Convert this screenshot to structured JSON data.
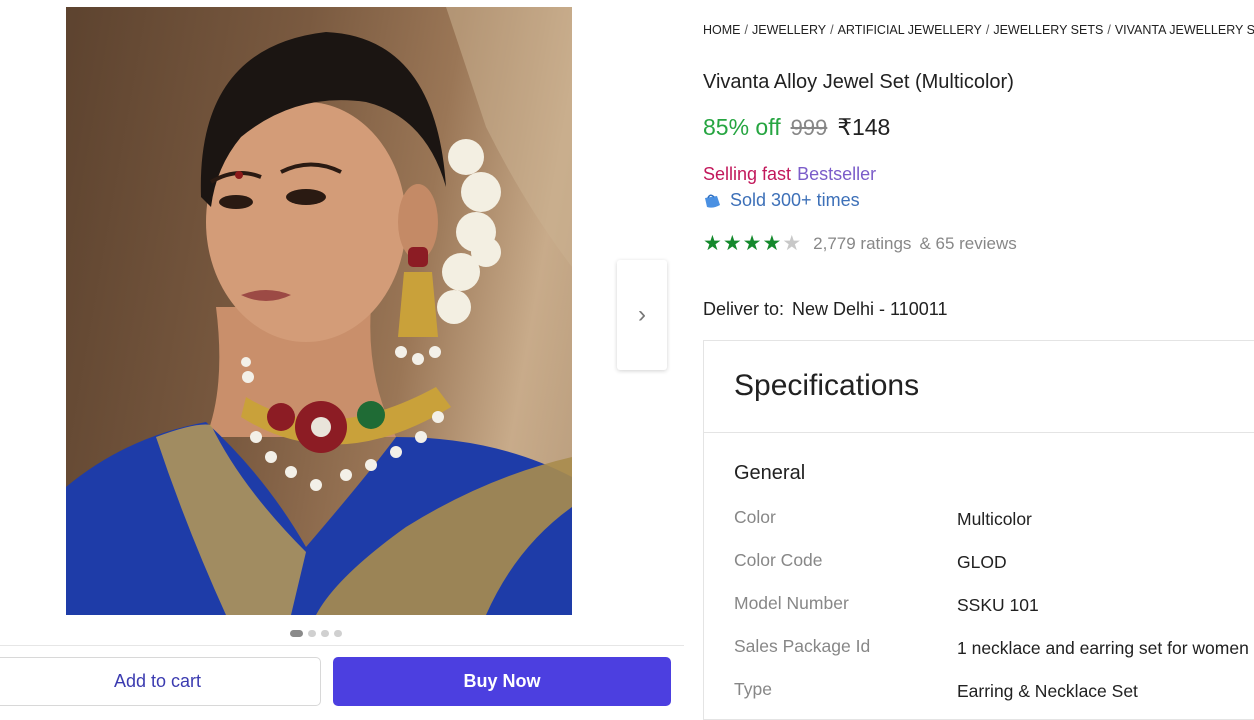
{
  "breadcrumb": [
    "HOME",
    "JEWELLERY",
    "ARTIFICIAL JEWELLERY",
    "JEWELLERY SETS",
    "VIVANTA JEWELLERY SETS"
  ],
  "product": {
    "title": "Vivanta Alloy Jewel Set (Multicolor)",
    "discount": "85% off",
    "mrp": "999",
    "price": "₹148",
    "tag_selling": "Selling fast",
    "tag_best": "Bestseller",
    "sold": "Sold 300+ times",
    "rating": 4,
    "ratings_text": "2,779 ratings",
    "reviews_text": "& 65 reviews"
  },
  "delivery": {
    "label": "Deliver to:",
    "location": "New Delhi - 110011"
  },
  "buttons": {
    "add_to_cart": "Add to cart",
    "buy_now": "Buy Now"
  },
  "gallery": {
    "total_images": 4,
    "active_index": 0
  },
  "specifications": {
    "title": "Specifications",
    "group": "General",
    "rows": [
      {
        "key": "Color",
        "value": "Multicolor"
      },
      {
        "key": "Color Code",
        "value": "GLOD"
      },
      {
        "key": "Model Number",
        "value": "SSKU 101"
      },
      {
        "key": "Sales Package Id",
        "value": "1 necklace and earring set for women"
      },
      {
        "key": "Type",
        "value": "Earring & Necklace Set"
      }
    ]
  },
  "colors": {
    "discount": "#26a541",
    "star": "#14892c",
    "buy_button": "#4c3fe0",
    "sold_text": "#3d70b8"
  }
}
